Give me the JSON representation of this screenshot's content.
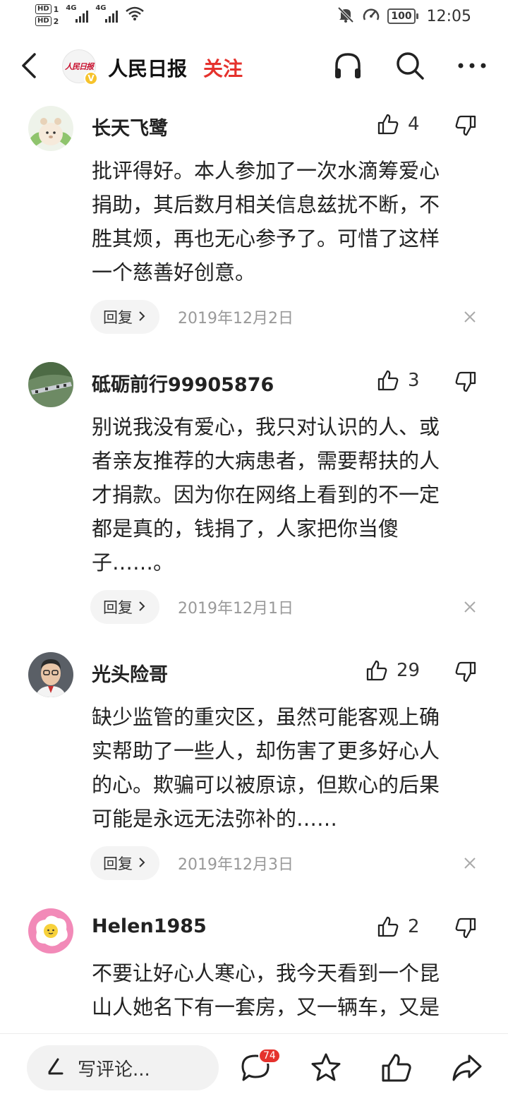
{
  "status_bar": {
    "hd1": "HD",
    "hd1_sub": "1",
    "hd2": "HD",
    "hd2_sub": "2",
    "net1": "4G",
    "net2": "4G",
    "battery": "100",
    "time": "12:05",
    "icons": [
      "signal-icon",
      "wifi-icon",
      "mute-bell-icon",
      "speedometer-icon",
      "battery-icon"
    ]
  },
  "header": {
    "brand_name": "人民日报",
    "brand_logo_text": "人民日报",
    "verified_badge": "V",
    "follow_label": "关注",
    "icons": [
      "back-icon",
      "headphones-icon",
      "search-icon",
      "more-icon"
    ],
    "accent_color": "#e5322d"
  },
  "comments": [
    {
      "username": "长天飞鹭",
      "likes": "4",
      "lines": [
        "批评得好。本人参加了一次水滴筹爱心",
        "捐助，其后数月相关信息兹扰不断，不",
        "胜其烦，再也无心参予了。可惜了这样",
        "一个慈善好创意。"
      ],
      "reply_label": "回复",
      "date": "2019年12月2日"
    },
    {
      "username": "砥砺前行99905876",
      "likes": "3",
      "lines": [
        "别说我没有爱心，我只对认识的人、或",
        "者亲友推荐的大病患者，需要帮扶的人",
        "才捐款。因为你在网络上看到的不一定",
        "都是真的，钱捐了，人家把你当傻",
        "子……。"
      ],
      "reply_label": "回复",
      "date": "2019年12月1日"
    },
    {
      "username": "光头险哥",
      "likes": "29",
      "lines": [
        "缺少监管的重灾区，虽然可能客观上确",
        "实帮助了一些人，却伤害了更多好心人",
        "的心。欺骗可以被原谅，但欺心的后果",
        "可能是永远无法弥补的……"
      ],
      "reply_label": "回复",
      "date": "2019年12月3日"
    },
    {
      "username": "Helen1985",
      "likes": "2",
      "lines": [
        "不要让好心人寒心，我今天看到一个昆",
        "山人她名下有一套房，又一辆车，又是"
      ]
    }
  ],
  "bottom_bar": {
    "comment_placeholder": "写评论...",
    "comment_count_badge": "74",
    "icons": [
      "pen-icon",
      "comment-bubble-icon",
      "star-icon",
      "thumbs-up-icon",
      "share-icon"
    ]
  }
}
